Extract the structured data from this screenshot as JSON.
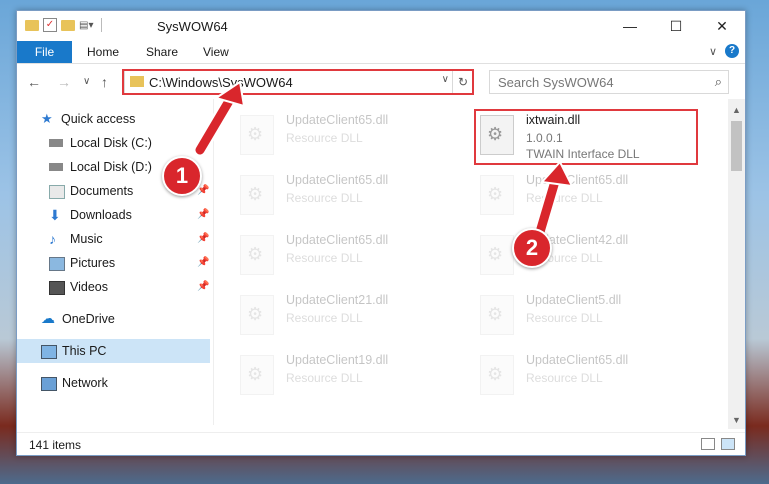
{
  "window": {
    "title": "SysWOW64",
    "controls": {
      "minimize": "—",
      "maximize": "☐",
      "close": "✕"
    }
  },
  "ribbon": {
    "tabs": [
      "File",
      "Home",
      "Share",
      "View"
    ],
    "expand": "∨",
    "help": "?"
  },
  "address": {
    "path": "C:\\Windows\\SysWOW64",
    "refresh": "↻",
    "dropdown": "∨"
  },
  "nav": {
    "back": "←",
    "forward": "→",
    "recent": "∨",
    "up": "↑"
  },
  "search": {
    "placeholder": "Search SysWOW64",
    "icon": "⌕"
  },
  "sidebar": {
    "items": [
      {
        "label": "Quick access",
        "icon": "star-icon",
        "pinned": false
      },
      {
        "label": "Local Disk (C:)",
        "icon": "drive-icon",
        "pinned": false
      },
      {
        "label": "Local Disk (D:)",
        "icon": "drive-icon",
        "pinned": false
      },
      {
        "label": "Documents",
        "icon": "documents-icon",
        "pinned": true
      },
      {
        "label": "Downloads",
        "icon": "download-icon",
        "pinned": true
      },
      {
        "label": "Music",
        "icon": "music-icon",
        "pinned": true
      },
      {
        "label": "Pictures",
        "icon": "pictures-icon",
        "pinned": true
      },
      {
        "label": "Videos",
        "icon": "videos-icon",
        "pinned": true
      },
      {
        "label": "OneDrive",
        "icon": "cloud-icon",
        "pinned": false
      },
      {
        "label": "This PC",
        "icon": "computer-icon",
        "pinned": false,
        "selected": true
      },
      {
        "label": "Network",
        "icon": "network-icon",
        "pinned": false
      }
    ]
  },
  "files": {
    "left": [
      {
        "name": "UpdateClient65.dll",
        "type": "Resource DLL"
      },
      {
        "name": "UpdateClient65.dll",
        "type": "Resource DLL"
      },
      {
        "name": "UpdateClient65.dll",
        "type": "Resource DLL"
      },
      {
        "name": "UpdateClient21.dll",
        "type": "Resource DLL"
      },
      {
        "name": "UpdateClient19.dll",
        "type": "Resource DLL"
      }
    ],
    "right": [
      {
        "name": "UpdateClient65.dll",
        "type": "Resource DLL"
      },
      {
        "name": "UpdateClient42.dll",
        "type": "Resource DLL"
      },
      {
        "name": "UpdateClient5.dll",
        "type": "Resource DLL"
      },
      {
        "name": "UpdateClient65.dll",
        "type": "Resource DLL"
      }
    ],
    "highlighted": {
      "name": "ixtwain.dll",
      "version": "1.0.0.1",
      "description": "TWAIN Interface DLL"
    }
  },
  "status": {
    "items": "141 items"
  },
  "callouts": [
    "1",
    "2"
  ],
  "colors": {
    "accent": "#1979ca",
    "highlight": "#e0393e",
    "selection": "#cce4f7"
  }
}
